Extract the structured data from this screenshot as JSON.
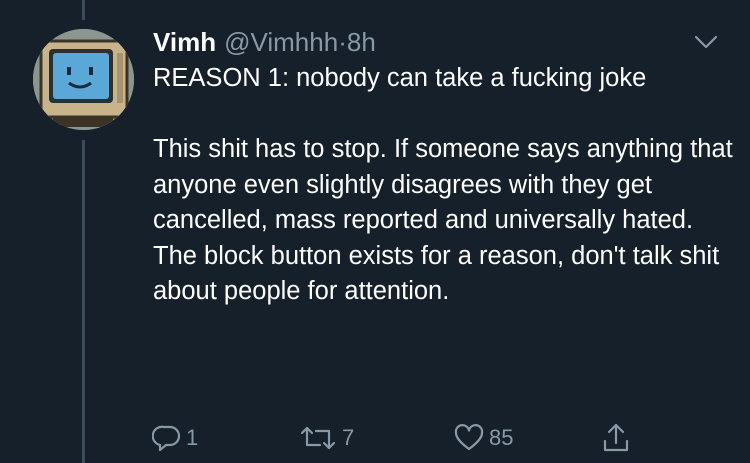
{
  "tweet": {
    "display_name": "Vimh",
    "handle": "@Vimhhh",
    "separator": "·",
    "time": "8h",
    "text_lines": [
      "REASON 1: nobody can take a fucking joke",
      "",
      "This shit has to stop. If someone says anything that anyone even slightly disagrees with they get cancelled, mass reported and universally hated. The block button exists for a reason, don't talk shit about people for attention."
    ],
    "avatar_icon": "smiling-computer-monitor"
  },
  "actions": {
    "reply_count": "1",
    "retweet_count": "7",
    "like_count": "85",
    "reply_icon": "reply-icon",
    "retweet_icon": "retweet-icon",
    "like_icon": "heart-icon",
    "share_icon": "share-icon"
  },
  "colors": {
    "background": "#15202b",
    "secondary_text": "#8899a6",
    "primary_text": "#ffffff",
    "thread_line": "#3d4a57"
  }
}
